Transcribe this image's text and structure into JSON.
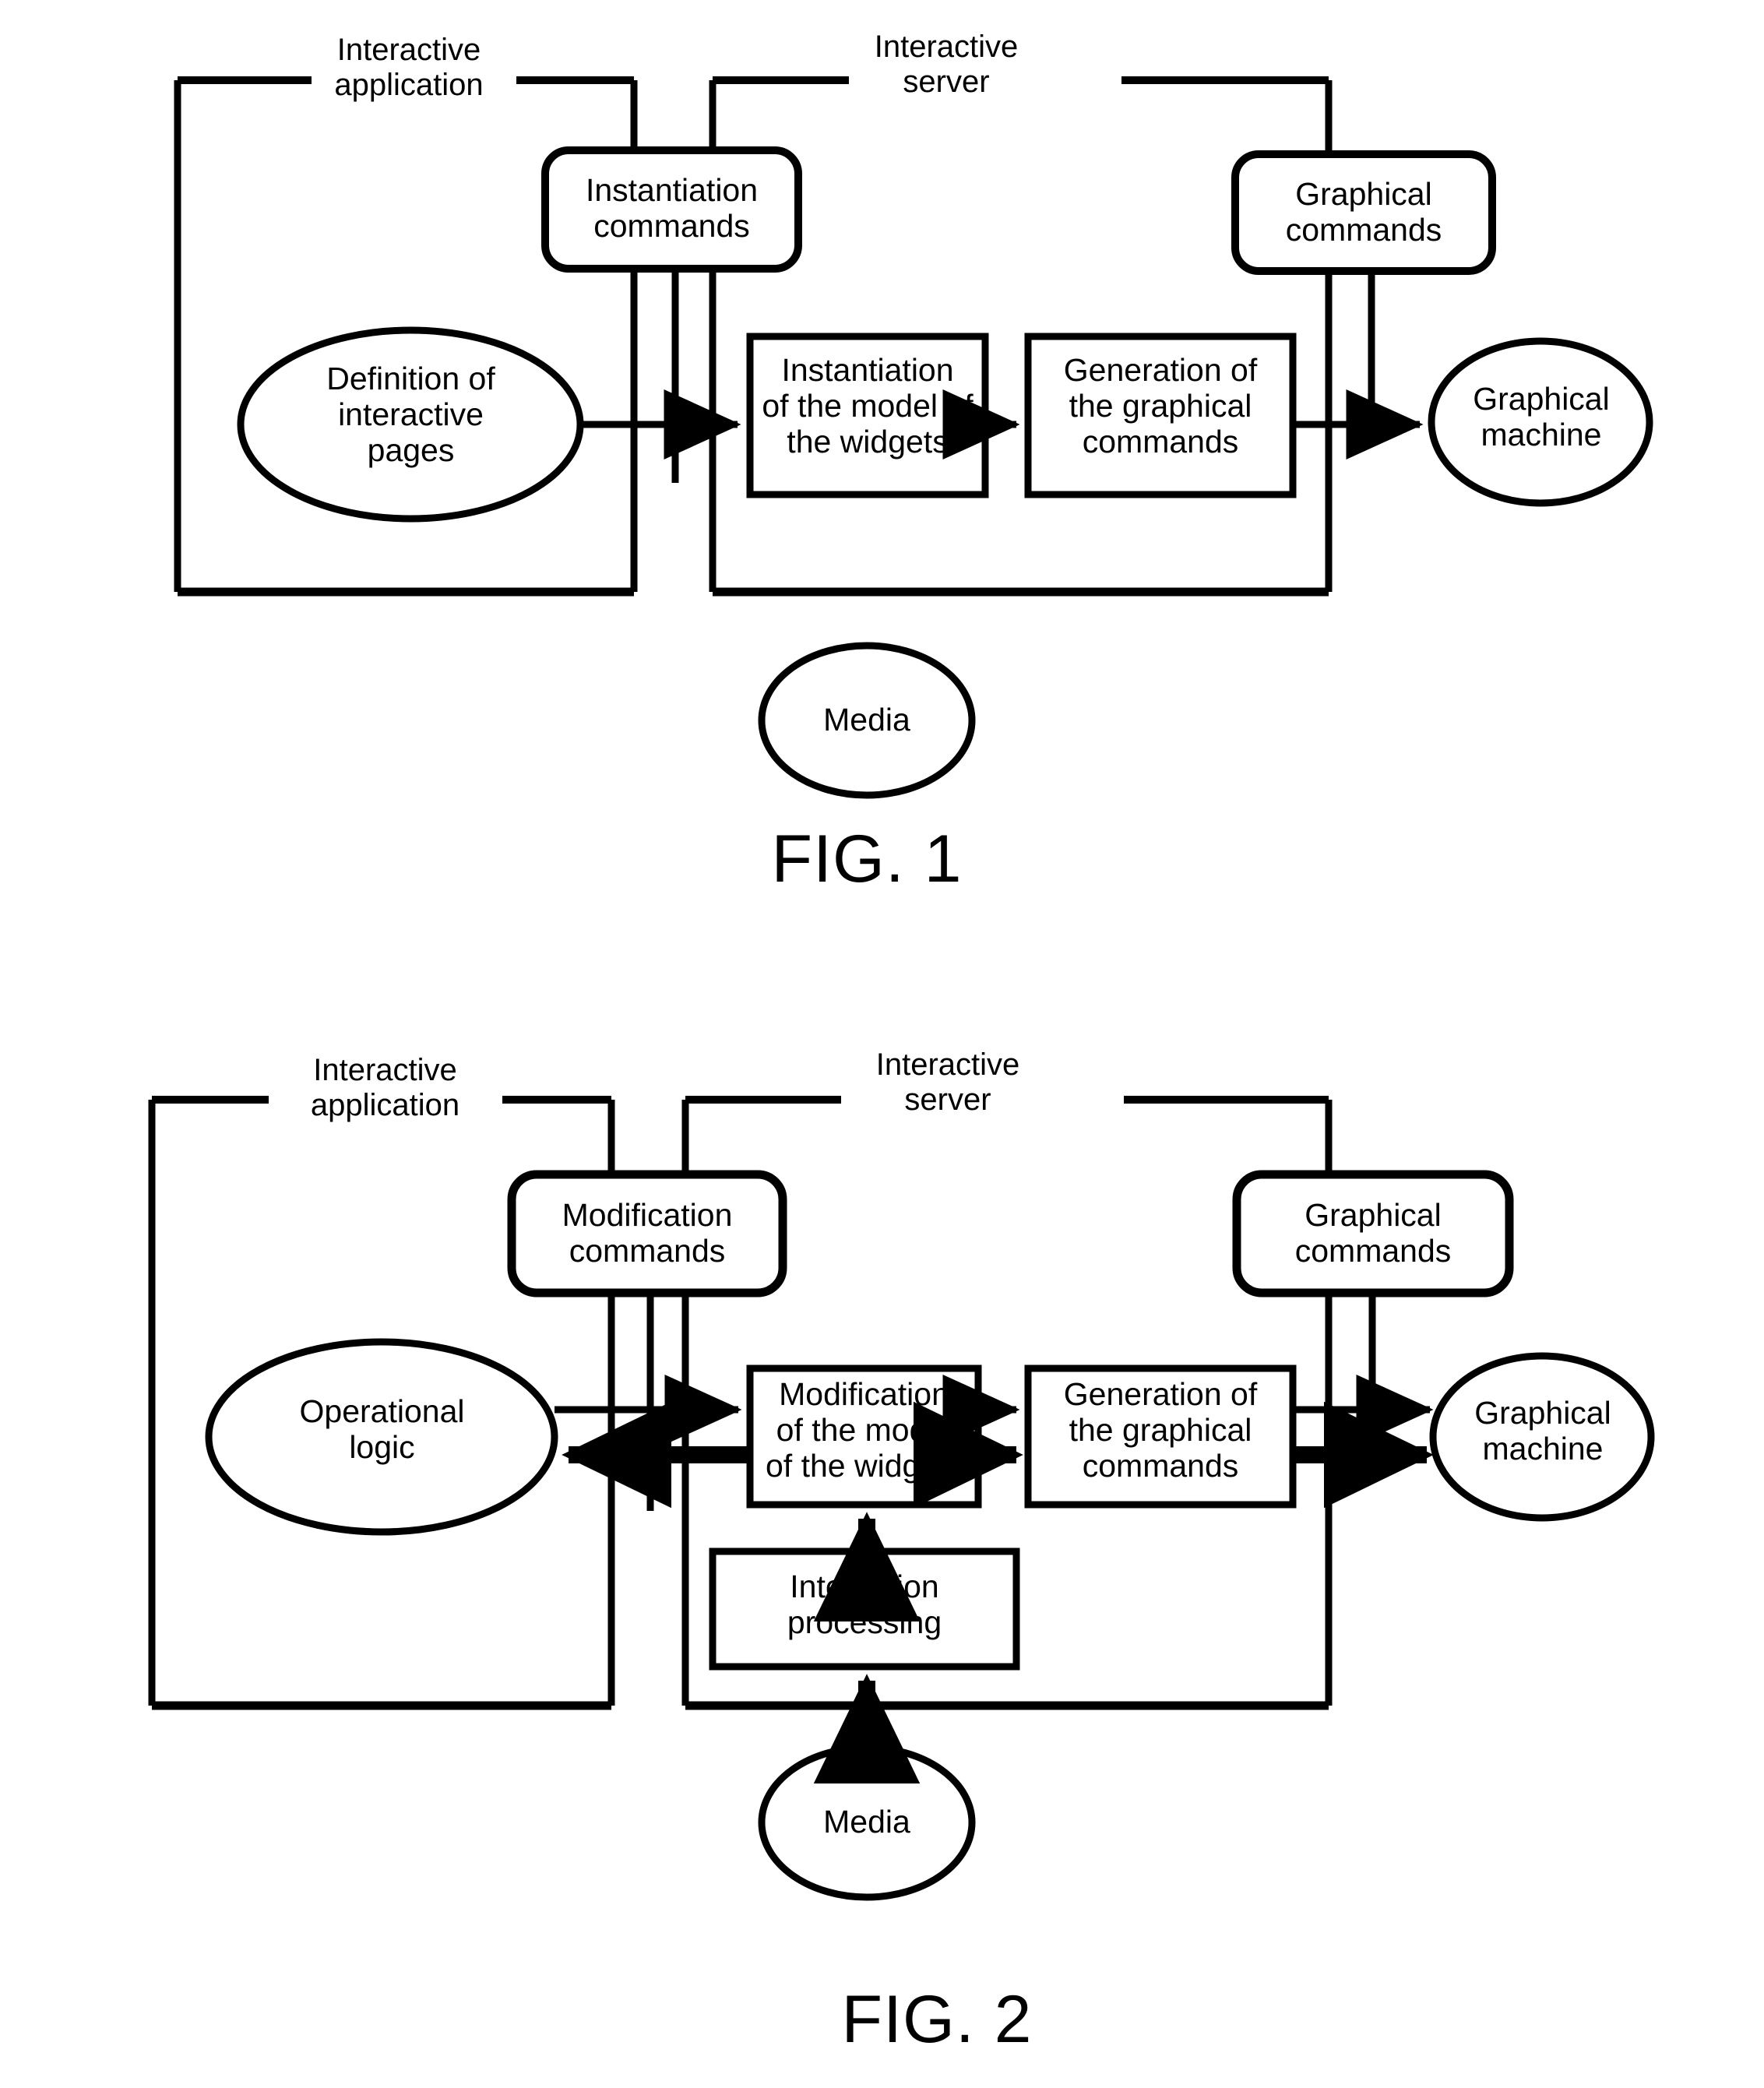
{
  "document": {
    "type": "patent-figure-sheet",
    "figures": [
      {
        "id": "fig1",
        "caption": "FIG. 1",
        "groups": [
          {
            "id": "interactive-application",
            "label": "Interactive\napplication"
          },
          {
            "id": "interactive-server",
            "label": "Interactive\nserver"
          }
        ],
        "rounded_boxes": [
          {
            "id": "instantiation-commands",
            "label": "Instantiation\ncommands"
          },
          {
            "id": "graphical-commands",
            "label": "Graphical\ncommands"
          }
        ],
        "ellipses": [
          {
            "id": "definition-of-interactive-pages",
            "label": "Definition of\ninteractive\npages"
          },
          {
            "id": "graphical-machine",
            "label": "Graphical\nmachine"
          },
          {
            "id": "media",
            "label": "Media"
          }
        ],
        "rect_boxes": [
          {
            "id": "instantiation-of-the-model-of-the-widgets",
            "label": "Instantiation\nof the model of\nthe widgets"
          },
          {
            "id": "generation-of-the-graphical-commands",
            "label": "Generation of\nthe graphical\ncommands"
          }
        ],
        "arrows": [
          {
            "from": "definition-of-interactive-pages",
            "to": "instantiation-of-the-model-of-the-widgets",
            "weight": "thin",
            "direction": "right"
          },
          {
            "from": "instantiation-of-the-model-of-the-widgets",
            "to": "generation-of-the-graphical-commands",
            "weight": "thin",
            "direction": "right"
          },
          {
            "from": "generation-of-the-graphical-commands",
            "to": "graphical-machine",
            "weight": "thin",
            "direction": "right"
          }
        ]
      },
      {
        "id": "fig2",
        "caption": "FIG. 2",
        "groups": [
          {
            "id": "interactive-application",
            "label": "Interactive\napplication"
          },
          {
            "id": "interactive-server",
            "label": "Interactive\nserver"
          }
        ],
        "rounded_boxes": [
          {
            "id": "modification-commands",
            "label": "Modification\ncommands"
          },
          {
            "id": "graphical-commands",
            "label": "Graphical\ncommands"
          }
        ],
        "ellipses": [
          {
            "id": "operational-logic",
            "label": "Operational\nlogic"
          },
          {
            "id": "graphical-machine",
            "label": "Graphical\nmachine"
          },
          {
            "id": "media",
            "label": "Media"
          }
        ],
        "rect_boxes": [
          {
            "id": "modification-of-the-model-of-the-widgets",
            "label": "Modification\nof the model\nof the widgets"
          },
          {
            "id": "generation-of-the-graphical-commands",
            "label": "Generation of\nthe graphical\ncommands"
          },
          {
            "id": "interaction-processing",
            "label": "Interaction\nprocessing"
          }
        ],
        "arrows": [
          {
            "from": "operational-logic",
            "to": "modification-of-the-model-of-the-widgets",
            "weight": "thin",
            "direction": "right"
          },
          {
            "from": "modification-of-the-model-of-the-widgets",
            "to": "operational-logic",
            "weight": "thick",
            "direction": "left"
          },
          {
            "from": "modification-of-the-model-of-the-widgets",
            "to": "generation-of-the-graphical-commands",
            "weight": "thin",
            "direction": "right"
          },
          {
            "from": "modification-of-the-model-of-the-widgets",
            "to": "generation-of-the-graphical-commands",
            "weight": "thick",
            "direction": "right"
          },
          {
            "from": "generation-of-the-graphical-commands",
            "to": "graphical-machine",
            "weight": "thin",
            "direction": "right"
          },
          {
            "from": "generation-of-the-graphical-commands",
            "to": "graphical-machine",
            "weight": "thick",
            "direction": "right"
          },
          {
            "from": "interaction-processing",
            "to": "modification-of-the-model-of-the-widgets",
            "weight": "thick",
            "direction": "up"
          },
          {
            "from": "media",
            "to": "interaction-processing",
            "weight": "thick",
            "direction": "up"
          }
        ]
      }
    ]
  },
  "colors": {
    "stroke": "#000000",
    "background": "#ffffff"
  }
}
